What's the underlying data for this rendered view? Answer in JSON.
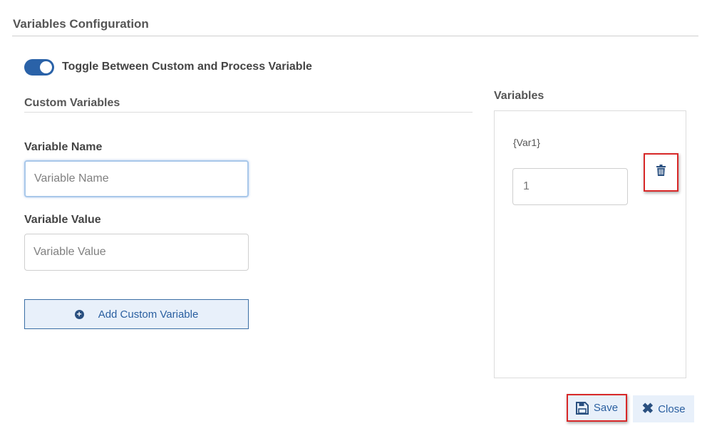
{
  "header": {
    "title": "Variables Configuration"
  },
  "toggle": {
    "label": "Toggle Between Custom and Process Variable",
    "on": true
  },
  "custom": {
    "heading": "Custom Variables",
    "name_label": "Variable Name",
    "name_placeholder": "Variable Name",
    "value_label": "Variable Value",
    "value_placeholder": "Variable Value",
    "add_label": "Add Custom Variable"
  },
  "variables": {
    "heading": "Variables",
    "items": [
      {
        "name": "{Var1}",
        "value": "1"
      }
    ]
  },
  "footer": {
    "save_label": "Save",
    "close_label": "Close"
  },
  "icons": {
    "add": "plus-circle-icon",
    "delete": "trash-icon",
    "save": "floppy-disk-icon",
    "close": "close-x-icon"
  },
  "colors": {
    "accent": "#2a62a8",
    "highlight": "#d82828",
    "button_bg": "#e8f0fa"
  }
}
